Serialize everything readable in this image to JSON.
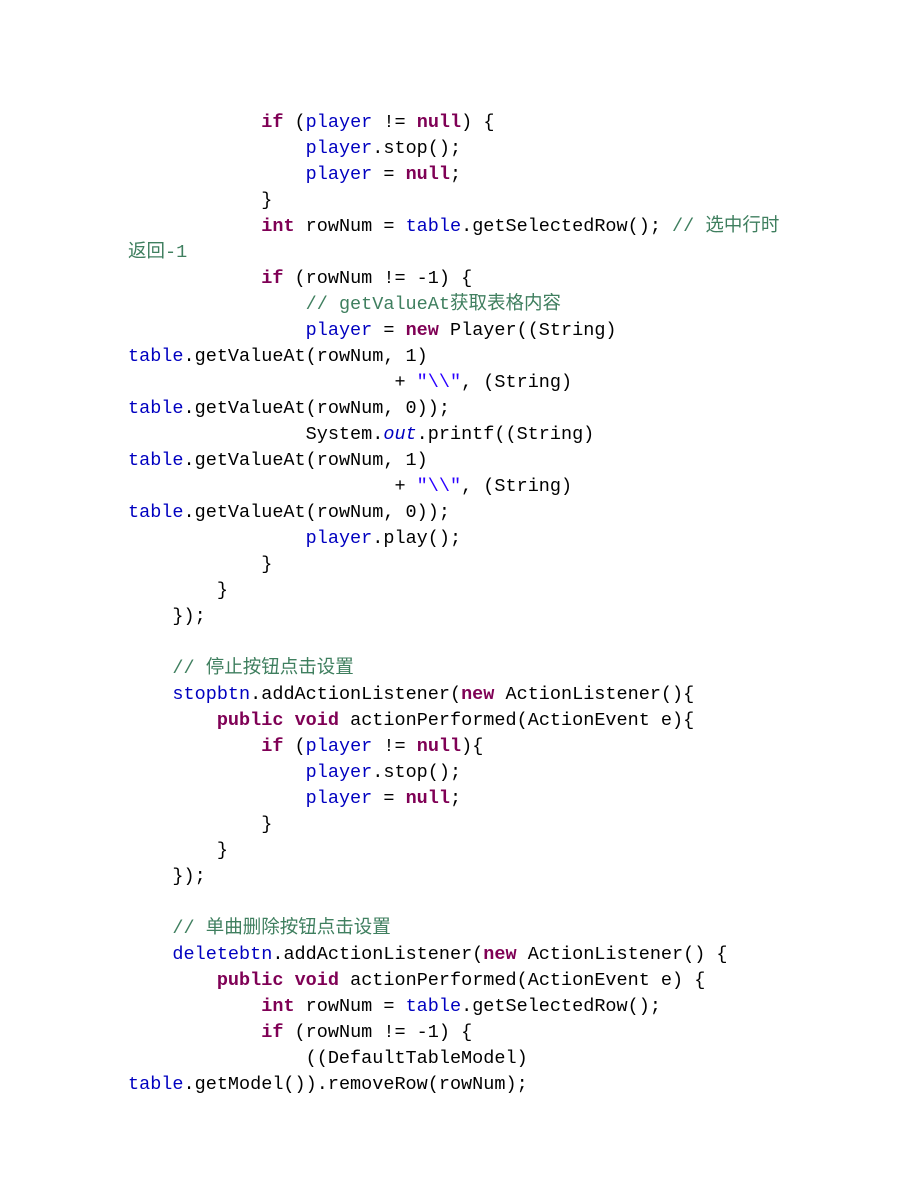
{
  "code": {
    "l1": {
      "a": "            ",
      "b": "if",
      "c": " (",
      "d": "player",
      "e": " != ",
      "f": "null",
      "g": ") {"
    },
    "l2": {
      "a": "                ",
      "b": "player",
      "c": ".stop();"
    },
    "l3": {
      "a": "                ",
      "b": "player",
      "c": " = ",
      "d": "null",
      "e": ";"
    },
    "l4": {
      "a": "            }"
    },
    "l5": {
      "a": "            ",
      "b": "int",
      "c": " rowNum = ",
      "d": "table",
      "e": ".getSelectedRow(); ",
      "f": "// 选中行时"
    },
    "l6": {
      "a": "返回-1"
    },
    "l7": {
      "a": "            ",
      "b": "if",
      "c": " (rowNum != -1) {"
    },
    "l8": {
      "a": "                ",
      "b": "// getValueAt获取表格内容"
    },
    "l9": {
      "a": "                ",
      "b": "player",
      "c": " = ",
      "d": "new",
      "e": " Player((String) "
    },
    "l10": {
      "a": "table",
      "b": ".getValueAt(rowNum, 1)"
    },
    "l11": {
      "a": "                        + ",
      "b": "\"\\\\\"",
      "c": ", (String) "
    },
    "l12": {
      "a": "table",
      "b": ".getValueAt(rowNum, 0));"
    },
    "l13": {
      "a": "                System.",
      "b": "out",
      "c": ".printf((String) "
    },
    "l14": {
      "a": "table",
      "b": ".getValueAt(rowNum, 1)"
    },
    "l15": {
      "a": "                        + ",
      "b": "\"\\\\\"",
      "c": ", (String) "
    },
    "l16": {
      "a": "table",
      "b": ".getValueAt(rowNum, 0));"
    },
    "l17": {
      "a": "                ",
      "b": "player",
      "c": ".play();"
    },
    "l18": {
      "a": "            }"
    },
    "l19": {
      "a": "        }"
    },
    "l20": {
      "a": "    });"
    },
    "l21": {
      "a": ""
    },
    "l22": {
      "a": "    ",
      "b": "// 停止按钮点击设置"
    },
    "l23": {
      "a": "    ",
      "b": "stopbtn",
      "c": ".addActionListener(",
      "d": "new",
      "e": " ActionListener(){"
    },
    "l24": {
      "a": "        ",
      "b": "public",
      "c": " ",
      "d": "void",
      "e": " actionPerformed(ActionEvent e){"
    },
    "l25": {
      "a": "            ",
      "b": "if",
      "c": " (",
      "d": "player",
      "e": " != ",
      "f": "null",
      "g": "){"
    },
    "l26": {
      "a": "                ",
      "b": "player",
      "c": ".stop();"
    },
    "l27": {
      "a": "                ",
      "b": "player",
      "c": " = ",
      "d": "null",
      "e": ";"
    },
    "l28": {
      "a": "            }"
    },
    "l29": {
      "a": "        }"
    },
    "l30": {
      "a": "    });"
    },
    "l31": {
      "a": ""
    },
    "l32": {
      "a": "    ",
      "b": "// 单曲删除按钮点击设置"
    },
    "l33": {
      "a": "    ",
      "b": "deletebtn",
      "c": ".addActionListener(",
      "d": "new",
      "e": " ActionListener() {"
    },
    "l34": {
      "a": "        ",
      "b": "public",
      "c": " ",
      "d": "void",
      "e": " actionPerformed(ActionEvent e) {"
    },
    "l35": {
      "a": "            ",
      "b": "int",
      "c": " rowNum = ",
      "d": "table",
      "e": ".getSelectedRow();"
    },
    "l36": {
      "a": "            ",
      "b": "if",
      "c": " (rowNum != -1) {"
    },
    "l37": {
      "a": "                ((DefaultTableModel) "
    },
    "l38": {
      "a": "table",
      "b": ".getModel()).removeRow(rowNum);"
    }
  }
}
